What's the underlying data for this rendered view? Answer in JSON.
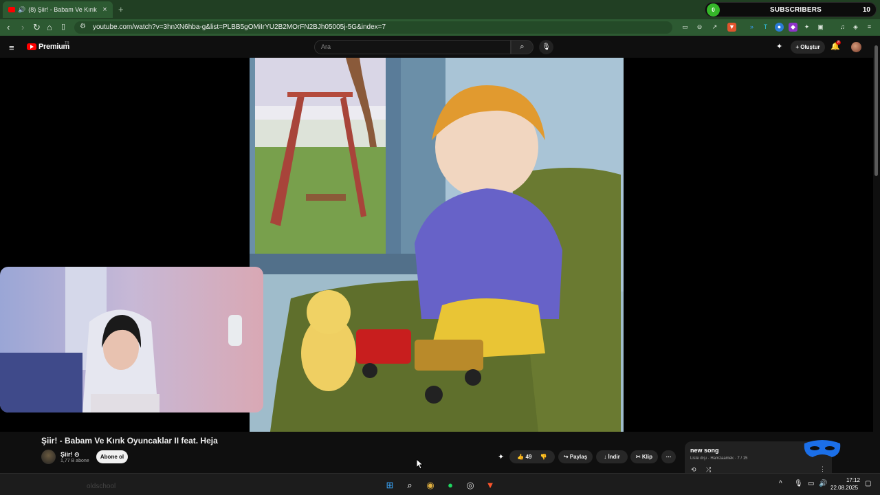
{
  "browser": {
    "tab_title": "(8) Şiir! - Babam Ve Kırık Oyu",
    "url": "youtube.com/watch?v=3hnXN6hba-g&list=PLBB5gOMiIrYU2B2MOrFN2BJh05005j-5G&index=7",
    "subscribers_widget": {
      "left_count": "0",
      "label": "SUBSCRIBERS",
      "right_count": "10"
    }
  },
  "youtube": {
    "logo_text": "Premium",
    "logo_cc": "TR",
    "search_placeholder": "Ara",
    "create_label": "Oluştur",
    "notif_count": "8"
  },
  "video": {
    "title": "Şiir! - Babam Ve Kırık Oyuncaklar II feat. Heja",
    "channel": "Şiir! ⊙",
    "channel_subs": "1,77 B abone",
    "subscribe_label": "Abone ol",
    "likes": "49",
    "share_label": "Paylaş",
    "download_label": "İndir",
    "clip_label": "Klip"
  },
  "playlist": {
    "title": "new song",
    "meta": "Liste dışı · Hamzaamek · 7 / 15"
  },
  "taskbar": {
    "time": "17:12",
    "date": "22.08.2025",
    "ghost_text": "oldschool"
  },
  "colors": {
    "accent_green": "#35b729",
    "youtube_red": "#ff0000",
    "chrome_green": "#2d5a32"
  }
}
